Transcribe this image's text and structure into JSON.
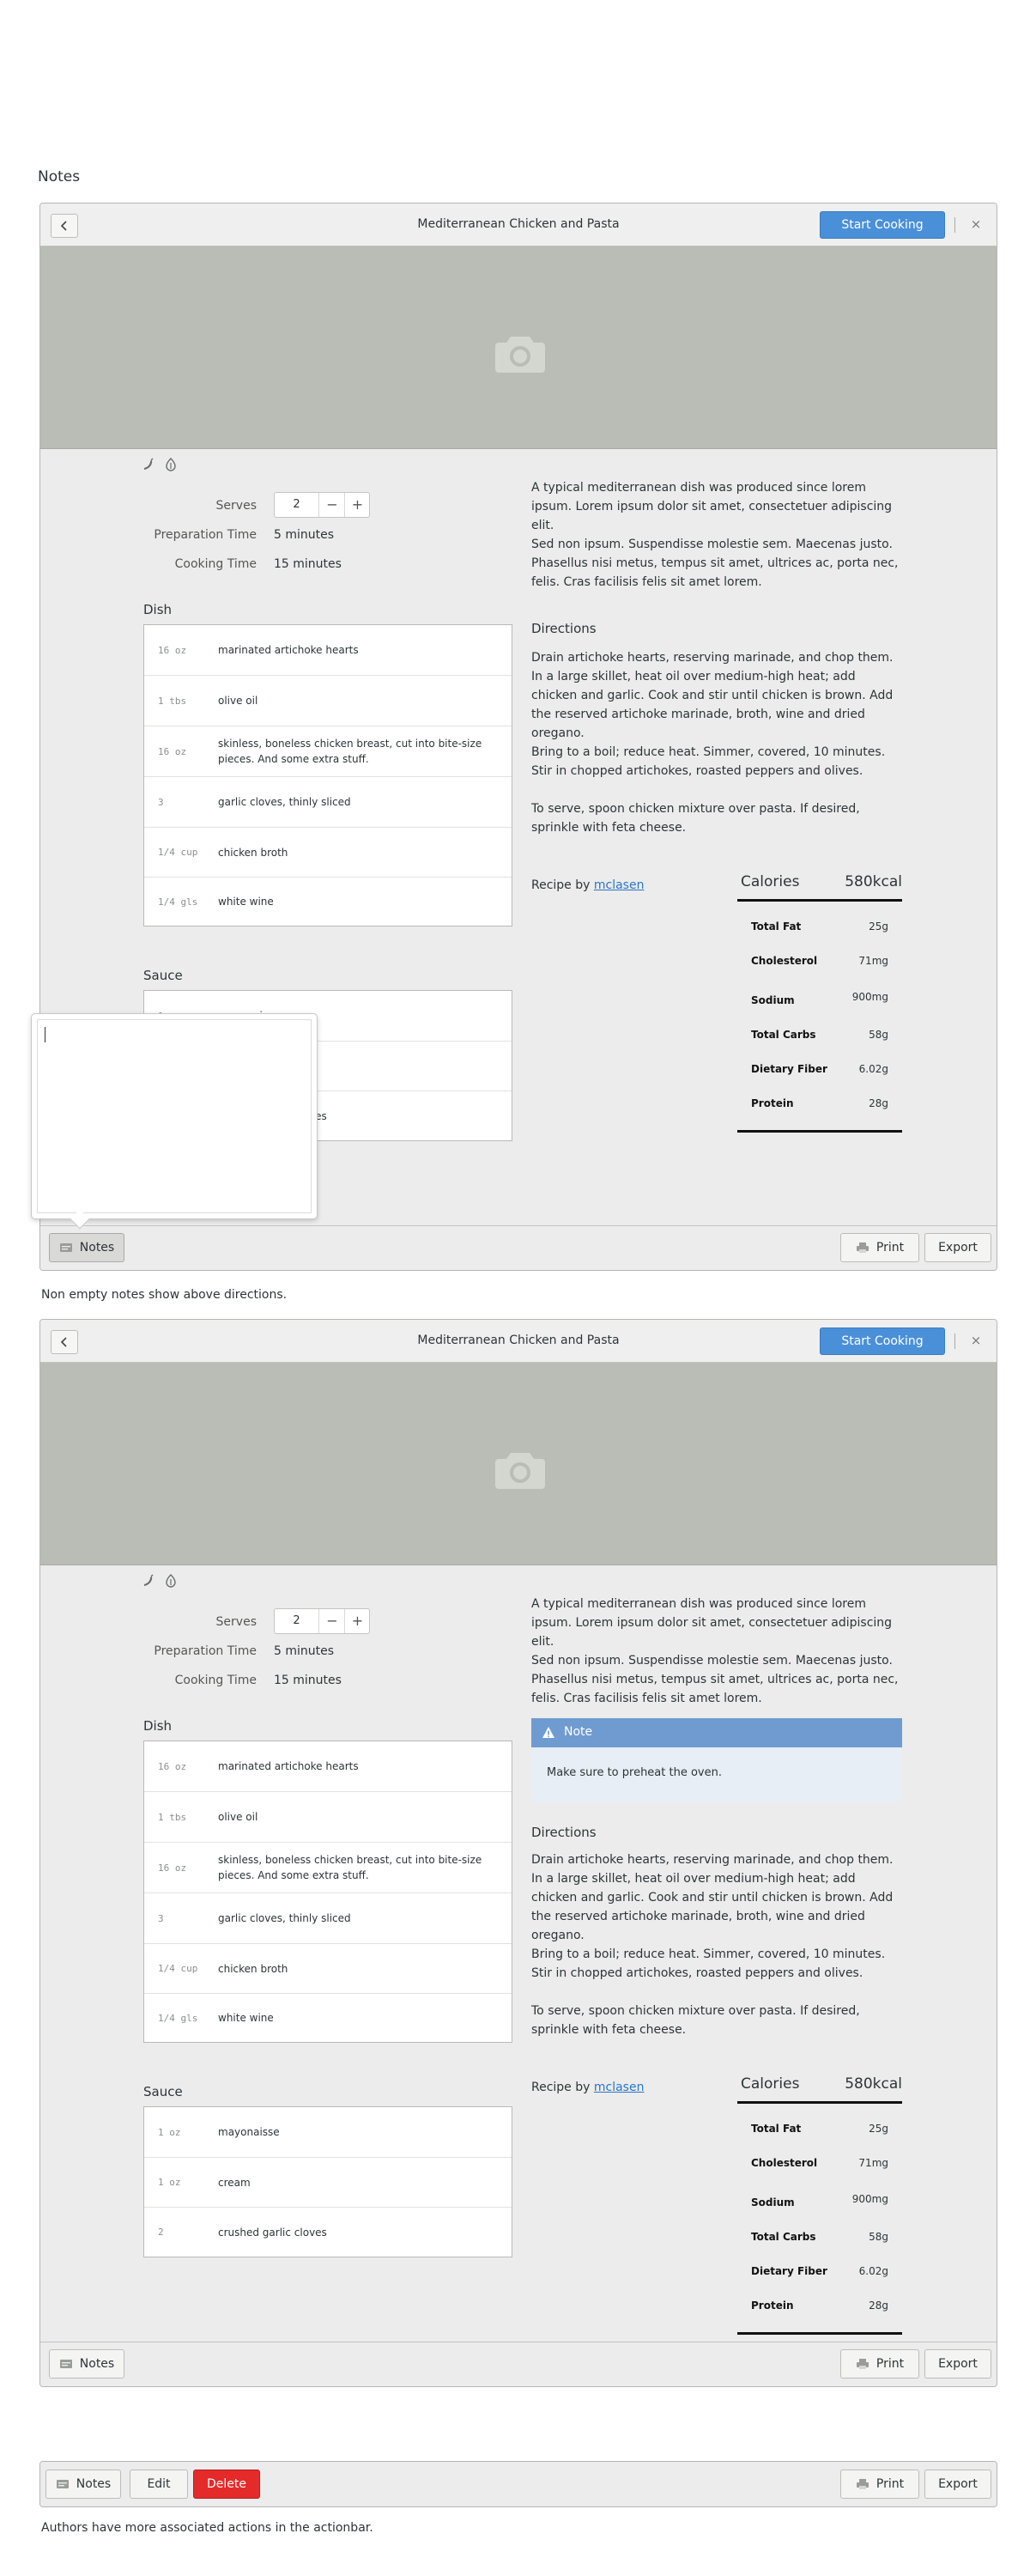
{
  "page": {
    "heading": "Notes",
    "caption_1": "Non empty notes show above directions.",
    "caption_2": "Authors have more associated actions in the actionbar."
  },
  "recipe": {
    "title": "Mediterranean Chicken and Pasta",
    "start_label": "Start Cooking",
    "close_glyph": "×",
    "serves_label": "Serves",
    "serves_value": "2",
    "minus_glyph": "−",
    "plus_glyph": "+",
    "prep_label": "Preparation Time",
    "prep_value": "5 minutes",
    "cook_label": "Cooking Time",
    "cook_value": "15 minutes",
    "description_1": "A typical mediterranean dish was produced since lorem ipsum. Lorem ipsum dolor sit amet, consectetuer adipiscing elit.",
    "description_2": "Sed non ipsum. Suspendisse molestie sem. Maecenas justo. Phasellus nisi metus, tempus sit amet, ultrices ac, porta nec, felis. Cras facilisis felis sit amet lorem.",
    "directions_title": "Directions",
    "directions": [
      "Drain artichoke hearts, reserving marinade, and chop them. In a large skillet, heat oil over medium-high heat; add chicken and garlic. Cook and stir until chicken is brown. Add the reserved artichoke marinade, broth, wine and dried oregano.",
      "Bring to a boil; reduce heat. Simmer, covered, 10 minutes. Stir in chopped artichokes, roasted peppers and olives.",
      "To serve, spoon chicken mixture over pasta. If desired, sprinkle with feta cheese."
    ],
    "recipe_by": "Recipe by",
    "author": "mclasen",
    "dish_title": "Dish",
    "dish": [
      {
        "qty": "16 oz",
        "name": "marinated artichoke hearts"
      },
      {
        "qty": "1 tbs",
        "name": "olive oil"
      },
      {
        "qty": "16 oz",
        "name": "skinless, boneless chicken breast, cut into bite-size pieces. And some extra stuff."
      },
      {
        "qty": "3",
        "name": "garlic cloves, thinly sliced"
      },
      {
        "qty": "1/4 cup",
        "name": "chicken broth"
      },
      {
        "qty": "1/4 gls",
        "name": "white wine"
      }
    ],
    "sauce_title": "Sauce",
    "sauce": [
      {
        "qty": "1 oz",
        "name": "mayonaisse"
      },
      {
        "qty": "1 oz",
        "name": "cream"
      },
      {
        "qty": "2",
        "name": "crushed garlic cloves"
      }
    ],
    "calories_label": "Calories",
    "calories_value": "580kcal",
    "nutrition": [
      {
        "k": "Total Fat",
        "v": "25g"
      },
      {
        "k": "Cholesterol",
        "v": "71mg"
      },
      {
        "k": "Sodium",
        "v": "900mg"
      },
      {
        "k": "Total Carbs",
        "v": "58g"
      },
      {
        "k": "Dietary Fiber",
        "v": "6.02g"
      },
      {
        "k": "Protein",
        "v": "28g"
      }
    ],
    "note_label": "Note",
    "note_text": "Make sure to preheat the oven."
  },
  "actionbar": {
    "notes_label": "Notes",
    "edit_label": "Edit",
    "delete_label": "Delete",
    "print_label": "Print",
    "export_label": "Export"
  },
  "colors": {
    "accent": "#4a90d9",
    "danger": "#e52a2a",
    "note_header": "#6f9bd0",
    "link": "#2a76c6"
  }
}
